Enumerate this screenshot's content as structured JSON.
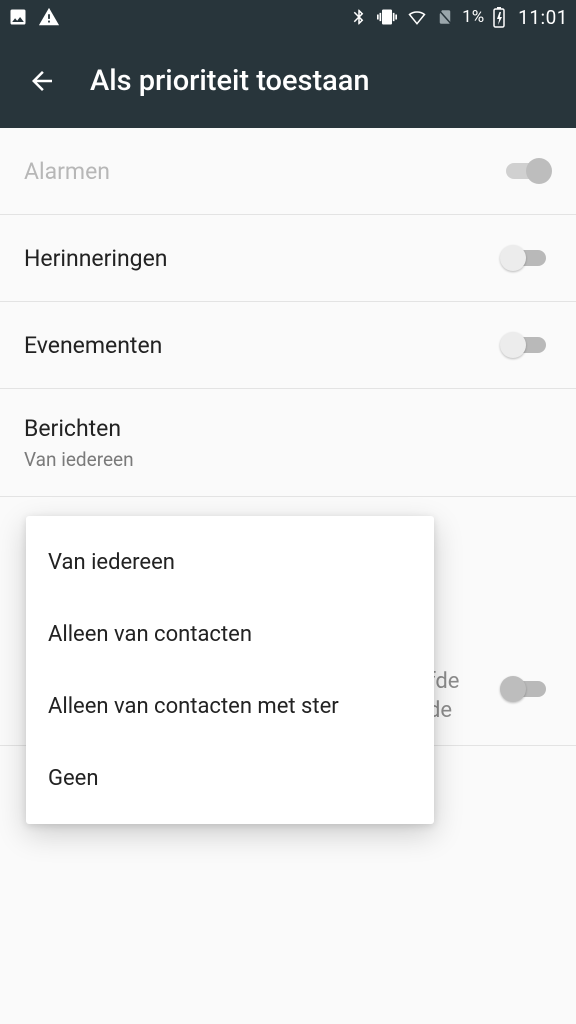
{
  "status": {
    "battery_pct": "1%",
    "clock": "11:01"
  },
  "header": {
    "title": "Als prioriteit toestaan"
  },
  "rows": {
    "alarms": {
      "label": "Alarmen"
    },
    "reminders": {
      "label": "Herinneringen"
    },
    "events": {
      "label": "Evenementen"
    },
    "messages": {
      "label": "Berichten",
      "sub": "Van iedereen"
    }
  },
  "bg": {
    "line1": "fde",
    "line2": "de"
  },
  "popup": {
    "opt1": "Van iedereen",
    "opt2": "Alleen van contacten",
    "opt3": "Alleen van contacten met ster",
    "opt4": "Geen"
  }
}
